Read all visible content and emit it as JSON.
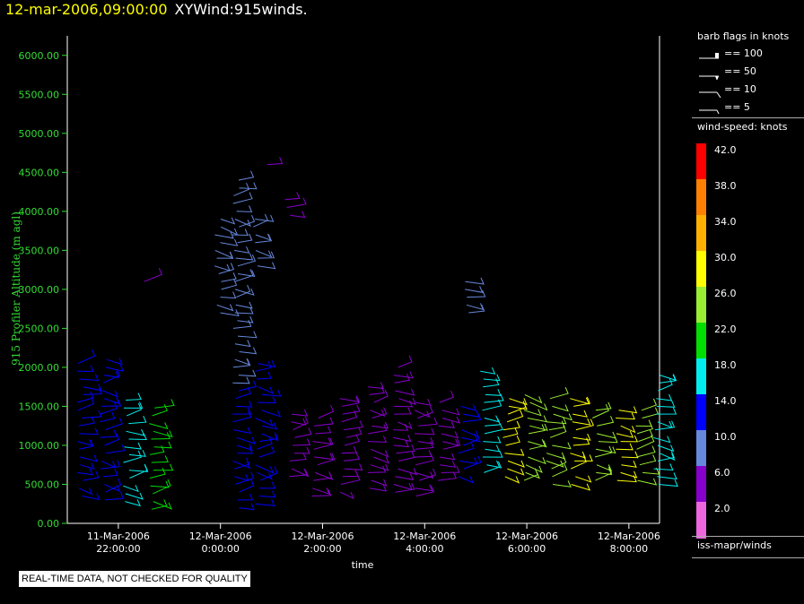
{
  "header": {
    "datetime": "12-mar-2006,09:00:00",
    "title": "XYWind:915winds."
  },
  "legend": {
    "barb_title": "barb flags in knots",
    "barb_flags": [
      "== 100",
      "== 50",
      "== 10",
      "== 5"
    ],
    "colorbar_title": "wind-speed: knots",
    "colorbar_labels": [
      "42.0",
      "38.0",
      "34.0",
      "30.0",
      "26.0",
      "22.0",
      "18.0",
      "14.0",
      "10.0",
      "6.0",
      "2.0"
    ],
    "colorbar_colors": [
      "#ff0000",
      "#ff8000",
      "#ffb000",
      "#ffff00",
      "#99ee33",
      "#00dd00",
      "#00eeee",
      "#0000ff",
      "#6688dd",
      "#8800cc",
      "#ee66dd"
    ],
    "source": "iss-mapr/winds"
  },
  "footer": {
    "notice": "REAL-TIME DATA, NOT CHECKED FOR QUALITY"
  },
  "chart_data": {
    "type": "scatter",
    "ylabel": "915 Profiler Altitude (m agl)",
    "xlabel": "time",
    "ylim": [
      0,
      6250
    ],
    "yticks": [
      "0.00",
      "500.00",
      "1000.00",
      "1500.00",
      "2000.00",
      "2500.00",
      "3000.00",
      "3500.00",
      "4000.00",
      "4500.00",
      "5000.00",
      "5500.00",
      "6000.00"
    ],
    "xlim": [
      -3,
      8.6
    ],
    "xticks": [
      {
        "v": -2,
        "l1": "11-Mar-2006",
        "l2": "22:00:00"
      },
      {
        "v": 0,
        "l1": "12-Mar-2006",
        "l2": "0:00:00"
      },
      {
        "v": 2,
        "l1": "12-Mar-2006",
        "l2": "2:00:00"
      },
      {
        "v": 4,
        "l1": "12-Mar-2006",
        "l2": "4:00:00"
      },
      {
        "v": 6,
        "l1": "12-Mar-2006",
        "l2": "6:00:00"
      },
      {
        "v": 8,
        "l1": "12-Mar-2006",
        "l2": "8:00:00"
      }
    ],
    "profiles": [
      {
        "t": -2.75,
        "bottom": 350,
        "top": 2100,
        "speed": 14
      },
      {
        "t": -2.3,
        "bottom": 300,
        "top": 2100,
        "speed": 14
      },
      {
        "t": -1.85,
        "bottom": 280,
        "top": 1600,
        "speed": 18
      },
      {
        "t": -1.35,
        "bottom": 180,
        "top": 1550,
        "speed": 22
      },
      {
        "t": -1.55,
        "bottom": 3100,
        "top": 3150,
        "speed": 6
      },
      {
        "t": -0.05,
        "bottom": 2700,
        "top": 3900,
        "speed": 10
      },
      {
        "t": 0.3,
        "bottom": 1800,
        "top": 4450,
        "speed": 10
      },
      {
        "t": 0.3,
        "bottom": 200,
        "top": 1700,
        "speed": 14
      },
      {
        "t": 0.7,
        "bottom": 3300,
        "top": 3950,
        "speed": 10
      },
      {
        "t": 0.75,
        "bottom": 250,
        "top": 2100,
        "speed": 14
      },
      {
        "t": 0.85,
        "bottom": 4600,
        "top": 4650,
        "speed": 6
      },
      {
        "t": 1.3,
        "bottom": 3950,
        "top": 4150,
        "speed": 6
      },
      {
        "t": 1.4,
        "bottom": 600,
        "top": 1450,
        "speed": 6
      },
      {
        "t": 1.85,
        "bottom": 350,
        "top": 1400,
        "speed": 6
      },
      {
        "t": 2.4,
        "bottom": 400,
        "top": 1600,
        "speed": 6
      },
      {
        "t": 2.95,
        "bottom": 450,
        "top": 1800,
        "speed": 6
      },
      {
        "t": 3.45,
        "bottom": 400,
        "top": 2000,
        "speed": 6
      },
      {
        "t": 3.85,
        "bottom": 350,
        "top": 1600,
        "speed": 6
      },
      {
        "t": 4.3,
        "bottom": 550,
        "top": 1600,
        "speed": 6
      },
      {
        "t": 4.7,
        "bottom": 600,
        "top": 1500,
        "speed": 14
      },
      {
        "t": 4.85,
        "bottom": 2700,
        "top": 3150,
        "speed": 10
      },
      {
        "t": 5.15,
        "bottom": 650,
        "top": 1950,
        "speed": 18
      },
      {
        "t": 5.6,
        "bottom": 600,
        "top": 1650,
        "speed": 30
      },
      {
        "t": 6.0,
        "bottom": 550,
        "top": 1650,
        "speed": 26
      },
      {
        "t": 6.45,
        "bottom": 500,
        "top": 1600,
        "speed": 26
      },
      {
        "t": 6.9,
        "bottom": 500,
        "top": 1650,
        "speed": 30
      },
      {
        "t": 7.35,
        "bottom": 550,
        "top": 1500,
        "speed": 26
      },
      {
        "t": 7.8,
        "bottom": 550,
        "top": 1500,
        "speed": 30
      },
      {
        "t": 8.2,
        "bottom": 550,
        "top": 1450,
        "speed": 26
      },
      {
        "t": 8.55,
        "bottom": 500,
        "top": 1950,
        "speed": 18
      }
    ]
  }
}
